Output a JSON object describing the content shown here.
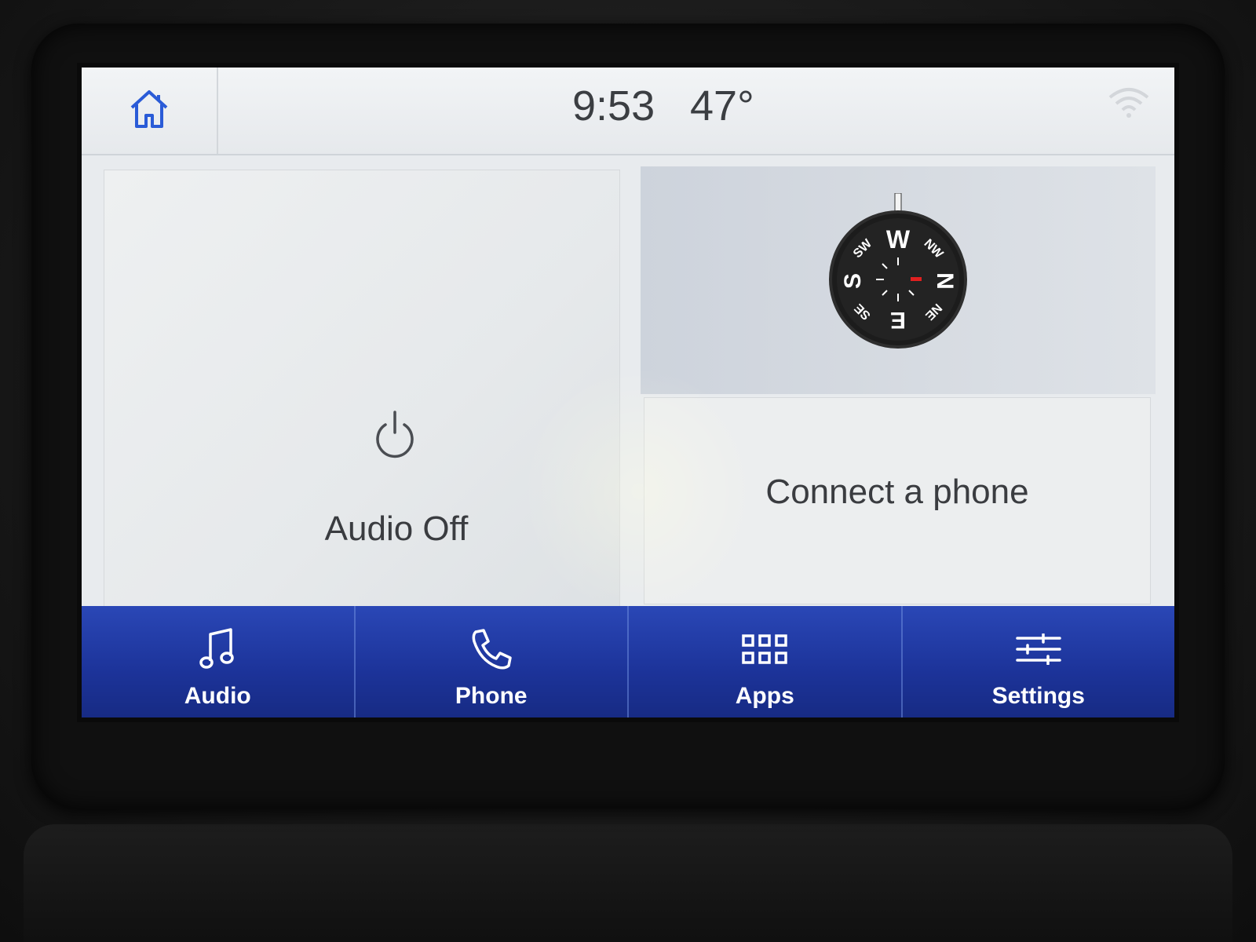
{
  "status_bar": {
    "time": "9:53",
    "temperature": "47°"
  },
  "tiles": {
    "audio": {
      "label": "Audio Off"
    },
    "phone": {
      "label": "Connect a phone"
    },
    "compass": {
      "heading": "W",
      "labels": [
        "N",
        "NE",
        "E",
        "SE",
        "S",
        "SW",
        "W",
        "NW"
      ]
    }
  },
  "nav": {
    "items": [
      {
        "label": "Audio",
        "icon": "music-note-icon"
      },
      {
        "label": "Phone",
        "icon": "phone-icon"
      },
      {
        "label": "Apps",
        "icon": "apps-grid-icon"
      },
      {
        "label": "Settings",
        "icon": "sliders-icon"
      }
    ]
  },
  "colors": {
    "accent": "#1f3aa6",
    "home_icon": "#2a5bd7"
  }
}
